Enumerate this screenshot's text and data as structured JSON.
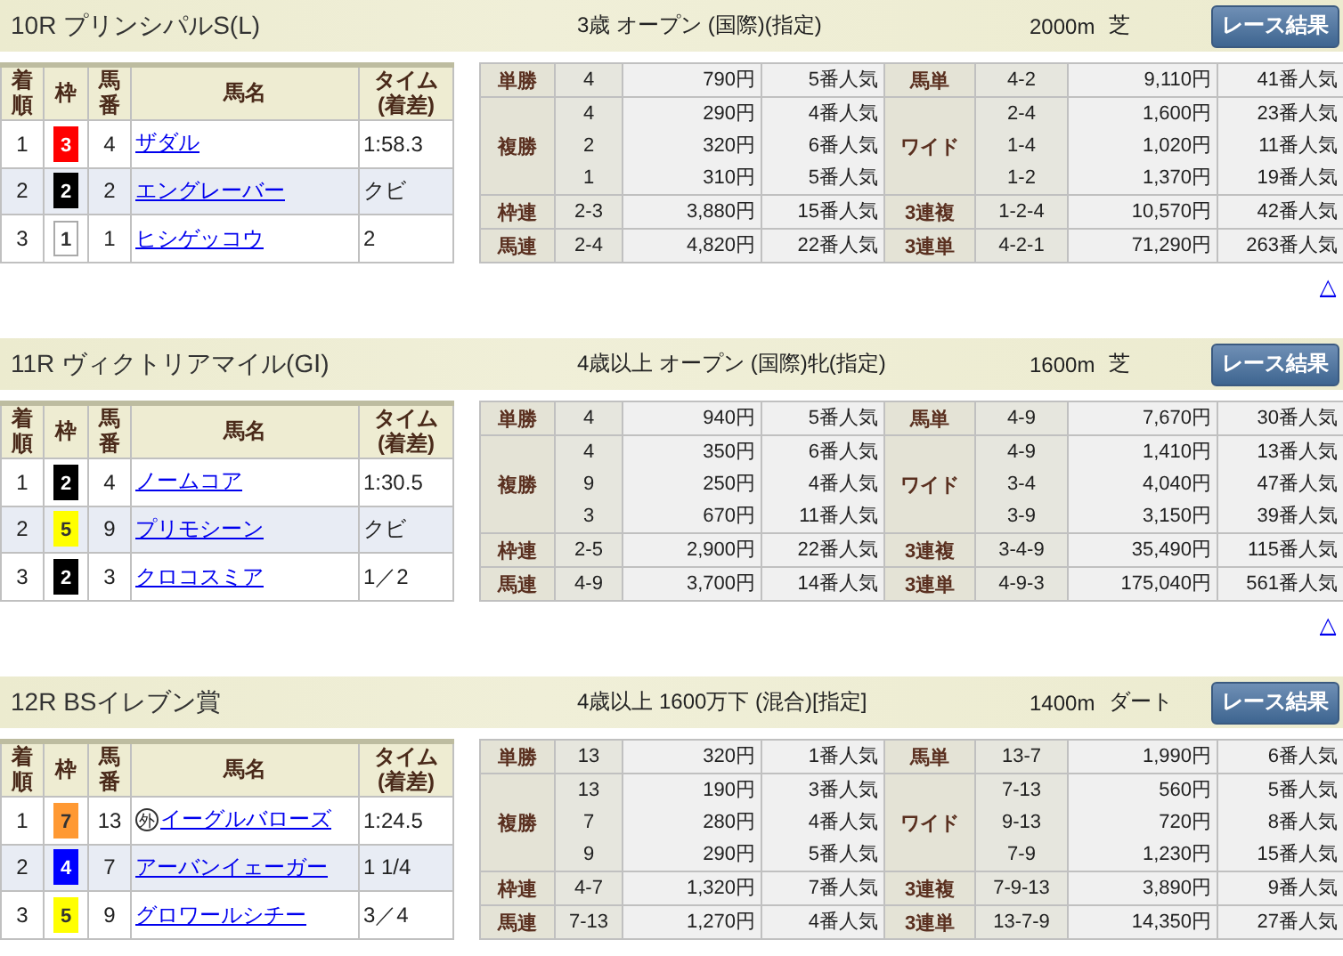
{
  "races": [
    {
      "title": "10R プリンシパルS(L)",
      "conditions": "3歳 オープン (国際)(指定)",
      "distance": "2000m",
      "surface": "芝",
      "button": "レース結果",
      "columns": [
        {
          "kind": "vertical",
          "label": "着順"
        },
        {
          "kind": "plain",
          "label": "枠"
        },
        {
          "kind": "vertical",
          "label": "馬番"
        },
        {
          "kind": "plain",
          "label": "馬名"
        },
        {
          "kind": "stacked",
          "lines": [
            "タイム",
            "(着差)"
          ]
        }
      ],
      "results": [
        {
          "rank": "1",
          "waku": "3",
          "color": "#ff0000",
          "number": "4",
          "name": "ザダル",
          "time": "1:58.3"
        },
        {
          "rank": "2",
          "waku": "2",
          "color": "#000000",
          "number": "2",
          "name": "エングレーバー",
          "time": "クビ"
        },
        {
          "rank": "3",
          "waku": "1",
          "color": "#ffffff",
          "number": "1",
          "name": "ヒシゲッコウ",
          "time": "2"
        }
      ],
      "payouts": [
        {
          "left": {
            "label": "単勝",
            "entries": [
              {
                "combo": "4",
                "amount": "790円",
                "popularity": "5番人気"
              }
            ]
          },
          "right": {
            "label": "馬単",
            "entries": [
              {
                "combo": "4-2",
                "amount": "9,110円",
                "popularity": "41番人気"
              }
            ]
          }
        },
        {
          "left": {
            "label": "複勝",
            "entries": [
              {
                "combo": "4",
                "amount": "290円",
                "popularity": "4番人気"
              },
              {
                "combo": "2",
                "amount": "320円",
                "popularity": "6番人気"
              },
              {
                "combo": "1",
                "amount": "310円",
                "popularity": "5番人気"
              }
            ]
          },
          "right": {
            "label": "ワイド",
            "entries": [
              {
                "combo": "2-4",
                "amount": "1,600円",
                "popularity": "23番人気"
              },
              {
                "combo": "1-4",
                "amount": "1,020円",
                "popularity": "11番人気"
              },
              {
                "combo": "1-2",
                "amount": "1,370円",
                "popularity": "19番人気"
              }
            ]
          }
        },
        {
          "left": {
            "label": "枠連",
            "entries": [
              {
                "combo": "2-3",
                "amount": "3,880円",
                "popularity": "15番人気"
              }
            ]
          },
          "right": {
            "label": "3連複",
            "entries": [
              {
                "combo": "1-2-4",
                "amount": "10,570円",
                "popularity": "42番人気"
              }
            ]
          }
        },
        {
          "left": {
            "label": "馬連",
            "entries": [
              {
                "combo": "2-4",
                "amount": "4,820円",
                "popularity": "22番人気"
              }
            ]
          },
          "right": {
            "label": "3連単",
            "entries": [
              {
                "combo": "4-2-1",
                "amount": "71,290円",
                "popularity": "263番人気"
              }
            ]
          }
        }
      ],
      "top_link": "△"
    },
    {
      "title": "11R ヴィクトリアマイル(GⅠ)",
      "conditions": "4歳以上 オープン (国際)牝(指定)",
      "distance": "1600m",
      "surface": "芝",
      "button": "レース結果",
      "columns": [
        {
          "kind": "vertical",
          "label": "着順"
        },
        {
          "kind": "plain",
          "label": "枠"
        },
        {
          "kind": "vertical",
          "label": "馬番"
        },
        {
          "kind": "plain",
          "label": "馬名"
        },
        {
          "kind": "stacked",
          "lines": [
            "タイム",
            "(着差)"
          ]
        }
      ],
      "results": [
        {
          "rank": "1",
          "waku": "2",
          "color": "#000000",
          "number": "4",
          "name": "ノームコア",
          "time": "1:30.5"
        },
        {
          "rank": "2",
          "waku": "5",
          "color": "#ffff00",
          "number": "9",
          "name": "プリモシーン",
          "time": "クビ"
        },
        {
          "rank": "3",
          "waku": "2",
          "color": "#000000",
          "number": "3",
          "name": "クロコスミア",
          "time": "1／2"
        }
      ],
      "payouts": [
        {
          "left": {
            "label": "単勝",
            "entries": [
              {
                "combo": "4",
                "amount": "940円",
                "popularity": "5番人気"
              }
            ]
          },
          "right": {
            "label": "馬単",
            "entries": [
              {
                "combo": "4-9",
                "amount": "7,670円",
                "popularity": "30番人気"
              }
            ]
          }
        },
        {
          "left": {
            "label": "複勝",
            "entries": [
              {
                "combo": "4",
                "amount": "350円",
                "popularity": "6番人気"
              },
              {
                "combo": "9",
                "amount": "250円",
                "popularity": "4番人気"
              },
              {
                "combo": "3",
                "amount": "670円",
                "popularity": "11番人気"
              }
            ]
          },
          "right": {
            "label": "ワイド",
            "entries": [
              {
                "combo": "4-9",
                "amount": "1,410円",
                "popularity": "13番人気"
              },
              {
                "combo": "3-4",
                "amount": "4,040円",
                "popularity": "47番人気"
              },
              {
                "combo": "3-9",
                "amount": "3,150円",
                "popularity": "39番人気"
              }
            ]
          }
        },
        {
          "left": {
            "label": "枠連",
            "entries": [
              {
                "combo": "2-5",
                "amount": "2,900円",
                "popularity": "22番人気"
              }
            ]
          },
          "right": {
            "label": "3連複",
            "entries": [
              {
                "combo": "3-4-9",
                "amount": "35,490円",
                "popularity": "115番人気"
              }
            ]
          }
        },
        {
          "left": {
            "label": "馬連",
            "entries": [
              {
                "combo": "4-9",
                "amount": "3,700円",
                "popularity": "14番人気"
              }
            ]
          },
          "right": {
            "label": "3連単",
            "entries": [
              {
                "combo": "4-9-3",
                "amount": "175,040円",
                "popularity": "561番人気"
              }
            ]
          }
        }
      ],
      "top_link": "△"
    },
    {
      "title": "12R BSイレブン賞",
      "conditions": "4歳以上 1600万下 (混合)[指定]",
      "distance": "1400m",
      "surface": "ダート",
      "button": "レース結果",
      "columns": [
        {
          "kind": "vertical",
          "label": "着順"
        },
        {
          "kind": "plain",
          "label": "枠"
        },
        {
          "kind": "vertical",
          "label": "馬番"
        },
        {
          "kind": "plain",
          "label": "馬名"
        },
        {
          "kind": "stacked",
          "lines": [
            "タイム",
            "(着差)"
          ]
        }
      ],
      "results": [
        {
          "rank": "1",
          "waku": "7",
          "color": "#ff9933",
          "number": "13",
          "mark": "外",
          "name": "イーグルバローズ",
          "time": "1:24.5"
        },
        {
          "rank": "2",
          "waku": "4",
          "color": "#0000ff",
          "number": "7",
          "name": "アーバンイェーガー",
          "time": "1 1/4"
        },
        {
          "rank": "3",
          "waku": "5",
          "color": "#ffff00",
          "number": "9",
          "name": "グロワールシチー",
          "time": "3／4"
        }
      ],
      "payouts": [
        {
          "left": {
            "label": "単勝",
            "entries": [
              {
                "combo": "13",
                "amount": "320円",
                "popularity": "1番人気"
              }
            ]
          },
          "right": {
            "label": "馬単",
            "entries": [
              {
                "combo": "13-7",
                "amount": "1,990円",
                "popularity": "6番人気"
              }
            ]
          }
        },
        {
          "left": {
            "label": "複勝",
            "entries": [
              {
                "combo": "13",
                "amount": "190円",
                "popularity": "3番人気"
              },
              {
                "combo": "7",
                "amount": "280円",
                "popularity": "4番人気"
              },
              {
                "combo": "9",
                "amount": "290円",
                "popularity": "5番人気"
              }
            ]
          },
          "right": {
            "label": "ワイド",
            "entries": [
              {
                "combo": "7-13",
                "amount": "560円",
                "popularity": "5番人気"
              },
              {
                "combo": "9-13",
                "amount": "720円",
                "popularity": "8番人気"
              },
              {
                "combo": "7-9",
                "amount": "1,230円",
                "popularity": "15番人気"
              }
            ]
          }
        },
        {
          "left": {
            "label": "枠連",
            "entries": [
              {
                "combo": "4-7",
                "amount": "1,320円",
                "popularity": "7番人気"
              }
            ]
          },
          "right": {
            "label": "3連複",
            "entries": [
              {
                "combo": "7-9-13",
                "amount": "3,890円",
                "popularity": "9番人気"
              }
            ]
          }
        },
        {
          "left": {
            "label": "馬連",
            "entries": [
              {
                "combo": "7-13",
                "amount": "1,270円",
                "popularity": "4番人気"
              }
            ]
          },
          "right": {
            "label": "3連単",
            "entries": [
              {
                "combo": "13-7-9",
                "amount": "14,350円",
                "popularity": "27番人気"
              }
            ]
          }
        }
      ]
    }
  ]
}
